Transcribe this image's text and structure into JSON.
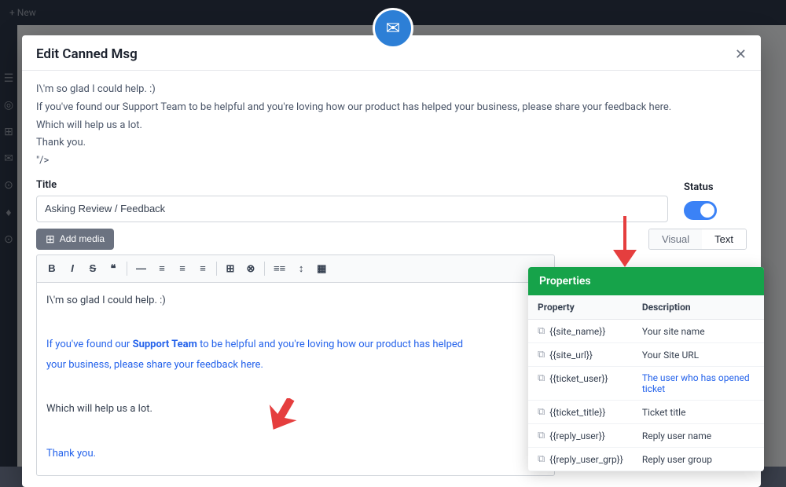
{
  "app": {
    "icon": "✉"
  },
  "topbar": {
    "new_label": "+ New"
  },
  "modal": {
    "title": "Edit Canned Msg",
    "close_label": "✕"
  },
  "preview": {
    "line1": "I\\'m so glad I could help. :)",
    "line2": "If you've found our Support Team to be helpful and you're loving how our product has helped your business, please share your feedback here.",
    "line3": "Which will help us a lot.",
    "line4": "Thank you.",
    "line5": "\"/>"
  },
  "form": {
    "title_label": "Title",
    "title_value": "Asking Review / Feedback",
    "status_label": "Status"
  },
  "toolbar": {
    "add_media_label": "Add media",
    "visual_tab": "Visual",
    "text_tab": "Text",
    "buttons": [
      "B",
      "I",
      "S",
      "\"",
      "—",
      "≡",
      "≡",
      "≡",
      "⊞",
      "⊗",
      "≡≡",
      "↕",
      "▦"
    ]
  },
  "editor": {
    "line1": "I\\'m so glad I could help. :)",
    "line2": "If you've found our Support Team to be helpful and you're loving how our product has",
    "line2b": "helped your business, please share your feedback here.",
    "line3": "Which will help us a lot.",
    "line4": "Thank you."
  },
  "properties": {
    "header": "Properties",
    "col_property": "Property",
    "col_description": "Description",
    "rows": [
      {
        "icon": "📋",
        "var": "{{site_name}}",
        "desc": "Your site name",
        "blue": false
      },
      {
        "icon": "📋",
        "var": "{{site_url}}",
        "desc": "Your Site URL",
        "blue": false
      },
      {
        "icon": "📋",
        "var": "{{ticket_user}}",
        "desc": "The user who has opened ticket",
        "blue": true
      },
      {
        "icon": "📋",
        "var": "{{ticket_title}}",
        "desc": "Ticket title",
        "blue": false
      },
      {
        "icon": "📋",
        "var": "{{reply_user}}",
        "desc": "Reply user name",
        "blue": false
      },
      {
        "icon": "📋",
        "var": "{{reply_user_grp}}",
        "desc": "Reply user group",
        "blue": false
      }
    ]
  }
}
